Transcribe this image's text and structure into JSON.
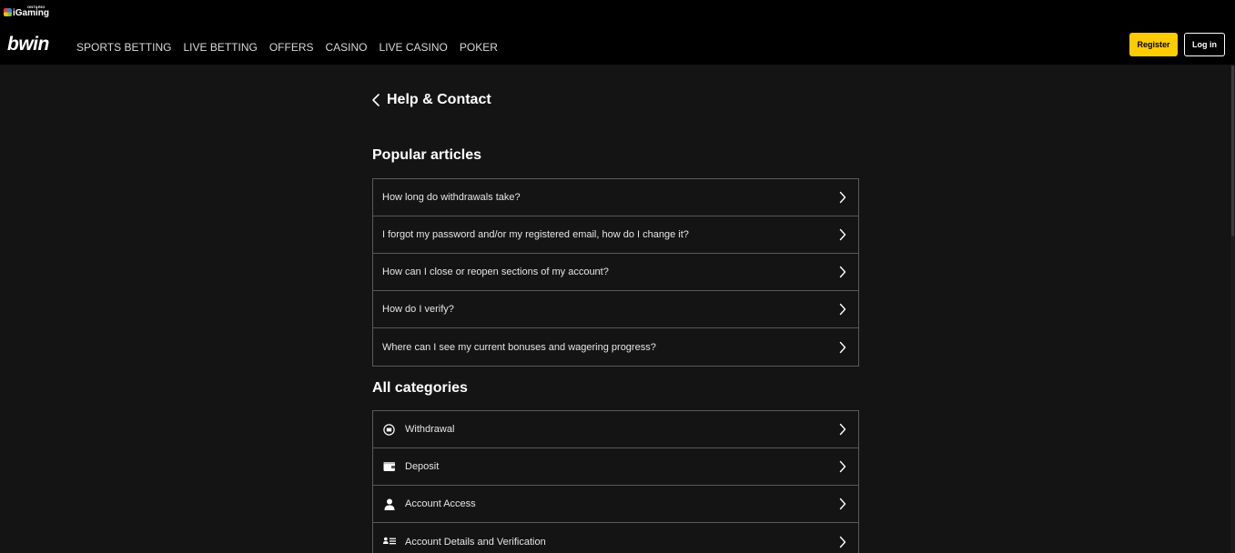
{
  "badge": {
    "text": "iGaming",
    "sup": "ONTARIO",
    "icon": "igaming-ontario-logo"
  },
  "brand": {
    "name": "bwin"
  },
  "nav": {
    "items": [
      {
        "label": "SPORTS BETTING"
      },
      {
        "label": "LIVE BETTING"
      },
      {
        "label": "OFFERS"
      },
      {
        "label": "CASINO"
      },
      {
        "label": "LIVE CASINO"
      },
      {
        "label": "POKER"
      }
    ]
  },
  "auth": {
    "register_label": "Register",
    "login_label": "Log in",
    "register_color": "#ffcc00"
  },
  "header": {
    "title": "Help & Contact",
    "back_icon": "chevron-left-icon"
  },
  "popular": {
    "title": "Popular articles",
    "items": [
      {
        "label": "How long do withdrawals take?"
      },
      {
        "label": "I forgot my password and/or my registered email, how do I change it?"
      },
      {
        "label": "How can I close or reopen sections of my account?"
      },
      {
        "label": "How do I verify?"
      },
      {
        "label": "Where can I see my current bonuses and wagering progress?"
      }
    ]
  },
  "categories": {
    "title": "All categories",
    "items": [
      {
        "label": "Withdrawal",
        "icon": "withdrawal-icon"
      },
      {
        "label": "Deposit",
        "icon": "wallet-icon"
      },
      {
        "label": "Account Access",
        "icon": "user-icon"
      },
      {
        "label": "Account Details and Verification",
        "icon": "id-card-icon"
      }
    ]
  }
}
